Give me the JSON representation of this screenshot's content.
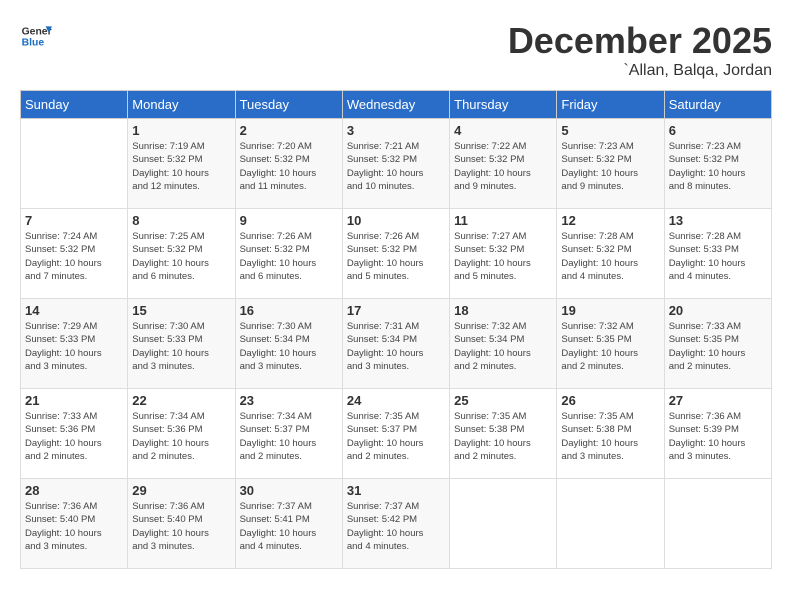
{
  "header": {
    "logo_line1": "General",
    "logo_line2": "Blue",
    "month": "December 2025",
    "location": "`Allan, Balqa, Jordan"
  },
  "weekdays": [
    "Sunday",
    "Monday",
    "Tuesday",
    "Wednesday",
    "Thursday",
    "Friday",
    "Saturday"
  ],
  "weeks": [
    [
      {
        "day": "",
        "info": ""
      },
      {
        "day": "1",
        "info": "Sunrise: 7:19 AM\nSunset: 5:32 PM\nDaylight: 10 hours\nand 12 minutes."
      },
      {
        "day": "2",
        "info": "Sunrise: 7:20 AM\nSunset: 5:32 PM\nDaylight: 10 hours\nand 11 minutes."
      },
      {
        "day": "3",
        "info": "Sunrise: 7:21 AM\nSunset: 5:32 PM\nDaylight: 10 hours\nand 10 minutes."
      },
      {
        "day": "4",
        "info": "Sunrise: 7:22 AM\nSunset: 5:32 PM\nDaylight: 10 hours\nand 9 minutes."
      },
      {
        "day": "5",
        "info": "Sunrise: 7:23 AM\nSunset: 5:32 PM\nDaylight: 10 hours\nand 9 minutes."
      },
      {
        "day": "6",
        "info": "Sunrise: 7:23 AM\nSunset: 5:32 PM\nDaylight: 10 hours\nand 8 minutes."
      }
    ],
    [
      {
        "day": "7",
        "info": "Sunrise: 7:24 AM\nSunset: 5:32 PM\nDaylight: 10 hours\nand 7 minutes."
      },
      {
        "day": "8",
        "info": "Sunrise: 7:25 AM\nSunset: 5:32 PM\nDaylight: 10 hours\nand 6 minutes."
      },
      {
        "day": "9",
        "info": "Sunrise: 7:26 AM\nSunset: 5:32 PM\nDaylight: 10 hours\nand 6 minutes."
      },
      {
        "day": "10",
        "info": "Sunrise: 7:26 AM\nSunset: 5:32 PM\nDaylight: 10 hours\nand 5 minutes."
      },
      {
        "day": "11",
        "info": "Sunrise: 7:27 AM\nSunset: 5:32 PM\nDaylight: 10 hours\nand 5 minutes."
      },
      {
        "day": "12",
        "info": "Sunrise: 7:28 AM\nSunset: 5:32 PM\nDaylight: 10 hours\nand 4 minutes."
      },
      {
        "day": "13",
        "info": "Sunrise: 7:28 AM\nSunset: 5:33 PM\nDaylight: 10 hours\nand 4 minutes."
      }
    ],
    [
      {
        "day": "14",
        "info": "Sunrise: 7:29 AM\nSunset: 5:33 PM\nDaylight: 10 hours\nand 3 minutes."
      },
      {
        "day": "15",
        "info": "Sunrise: 7:30 AM\nSunset: 5:33 PM\nDaylight: 10 hours\nand 3 minutes."
      },
      {
        "day": "16",
        "info": "Sunrise: 7:30 AM\nSunset: 5:34 PM\nDaylight: 10 hours\nand 3 minutes."
      },
      {
        "day": "17",
        "info": "Sunrise: 7:31 AM\nSunset: 5:34 PM\nDaylight: 10 hours\nand 3 minutes."
      },
      {
        "day": "18",
        "info": "Sunrise: 7:32 AM\nSunset: 5:34 PM\nDaylight: 10 hours\nand 2 minutes."
      },
      {
        "day": "19",
        "info": "Sunrise: 7:32 AM\nSunset: 5:35 PM\nDaylight: 10 hours\nand 2 minutes."
      },
      {
        "day": "20",
        "info": "Sunrise: 7:33 AM\nSunset: 5:35 PM\nDaylight: 10 hours\nand 2 minutes."
      }
    ],
    [
      {
        "day": "21",
        "info": "Sunrise: 7:33 AM\nSunset: 5:36 PM\nDaylight: 10 hours\nand 2 minutes."
      },
      {
        "day": "22",
        "info": "Sunrise: 7:34 AM\nSunset: 5:36 PM\nDaylight: 10 hours\nand 2 minutes."
      },
      {
        "day": "23",
        "info": "Sunrise: 7:34 AM\nSunset: 5:37 PM\nDaylight: 10 hours\nand 2 minutes."
      },
      {
        "day": "24",
        "info": "Sunrise: 7:35 AM\nSunset: 5:37 PM\nDaylight: 10 hours\nand 2 minutes."
      },
      {
        "day": "25",
        "info": "Sunrise: 7:35 AM\nSunset: 5:38 PM\nDaylight: 10 hours\nand 2 minutes."
      },
      {
        "day": "26",
        "info": "Sunrise: 7:35 AM\nSunset: 5:38 PM\nDaylight: 10 hours\nand 3 minutes."
      },
      {
        "day": "27",
        "info": "Sunrise: 7:36 AM\nSunset: 5:39 PM\nDaylight: 10 hours\nand 3 minutes."
      }
    ],
    [
      {
        "day": "28",
        "info": "Sunrise: 7:36 AM\nSunset: 5:40 PM\nDaylight: 10 hours\nand 3 minutes."
      },
      {
        "day": "29",
        "info": "Sunrise: 7:36 AM\nSunset: 5:40 PM\nDaylight: 10 hours\nand 3 minutes."
      },
      {
        "day": "30",
        "info": "Sunrise: 7:37 AM\nSunset: 5:41 PM\nDaylight: 10 hours\nand 4 minutes."
      },
      {
        "day": "31",
        "info": "Sunrise: 7:37 AM\nSunset: 5:42 PM\nDaylight: 10 hours\nand 4 minutes."
      },
      {
        "day": "",
        "info": ""
      },
      {
        "day": "",
        "info": ""
      },
      {
        "day": "",
        "info": ""
      }
    ]
  ]
}
